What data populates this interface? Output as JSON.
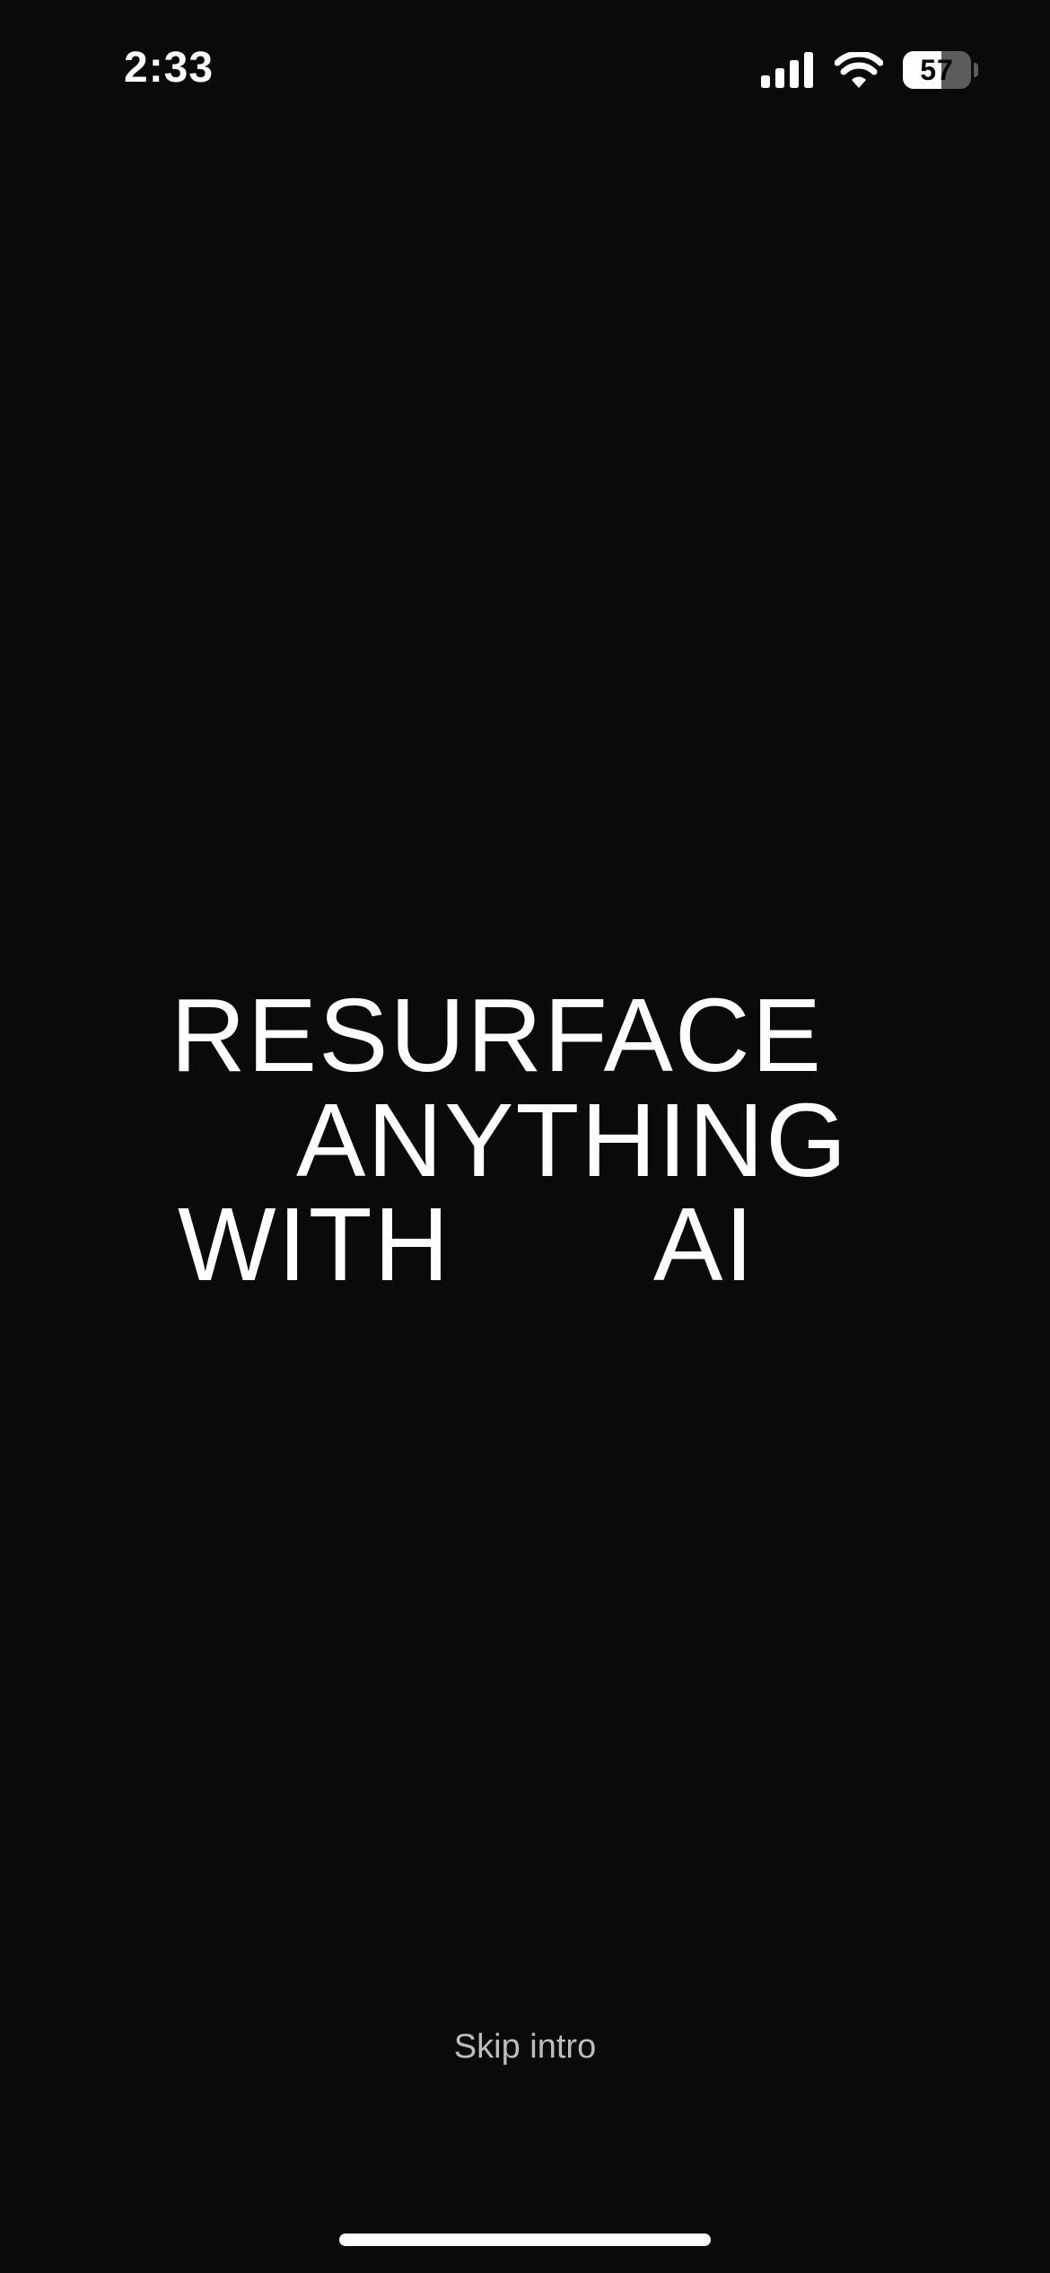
{
  "status_bar": {
    "time": "2:33",
    "battery_level": "57",
    "battery_fraction": 0.57,
    "icons": [
      "signal-icon",
      "wifi-icon",
      "battery-icon"
    ]
  },
  "headline": {
    "line1": "RESURFACE",
    "line2": "ANYTHING",
    "line3_word1": "WITH",
    "line3_word2": "AI"
  },
  "skip": {
    "label": "Skip intro"
  },
  "colors": {
    "background": "#0a0a0a",
    "text": "#ffffff",
    "skip_text": "#bdbdbd"
  }
}
